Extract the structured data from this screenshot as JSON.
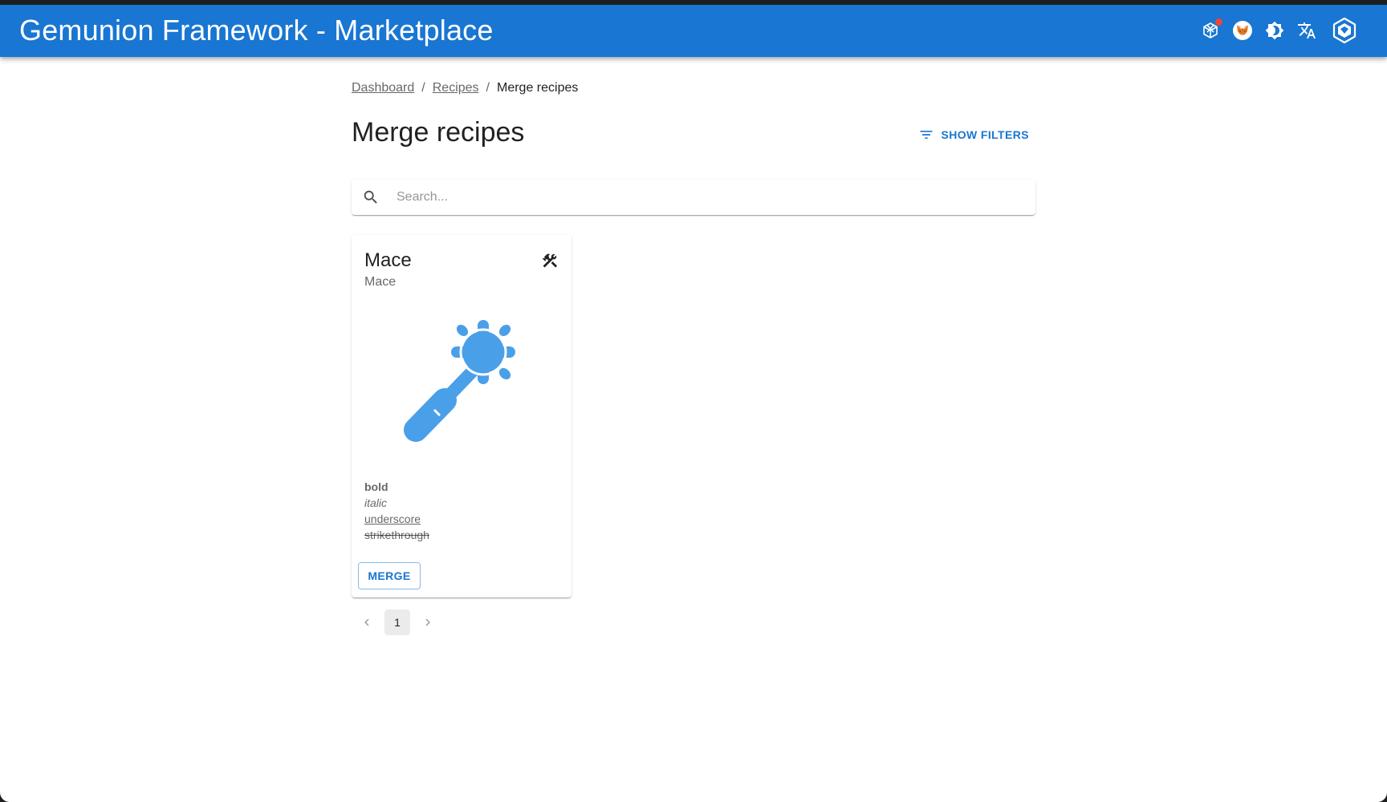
{
  "app": {
    "title": "Gemunion Framework - Marketplace",
    "brand_color": "#1976d2",
    "header_icons": [
      "network-switch-icon",
      "metamask-icon",
      "theme-toggle-icon",
      "translate-icon",
      "wallet-icon"
    ],
    "notification_color": "#f44336"
  },
  "breadcrumbs": {
    "items": [
      {
        "label": "Dashboard"
      },
      {
        "label": "Recipes"
      },
      {
        "label": "Merge recipes"
      }
    ],
    "separator": "/"
  },
  "page": {
    "title": "Merge recipes",
    "filters_button_label": "SHOW FILTERS"
  },
  "search": {
    "placeholder": "Search...",
    "value": ""
  },
  "cards": [
    {
      "title": "Mace",
      "subtitle": "Mace",
      "image_icon": "mace-icon",
      "image_color": "#4a9fe9",
      "description": [
        "bold",
        "italic",
        "underscore",
        "strikethrough"
      ],
      "action_label": "MERGE",
      "action_icon": "hammer-wrench-icon"
    }
  ],
  "pagination": {
    "current_page": "1"
  }
}
